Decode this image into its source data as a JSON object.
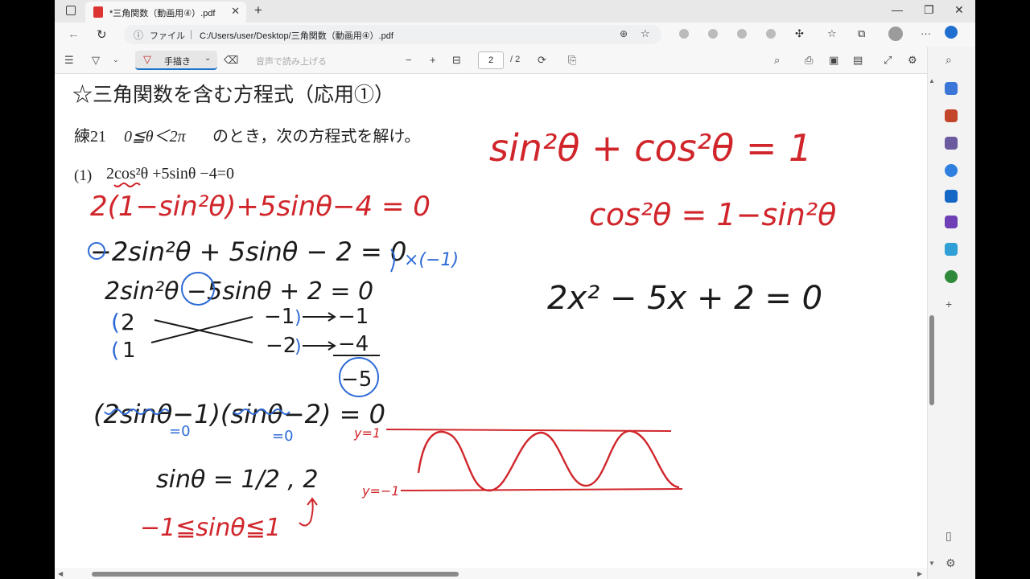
{
  "tab": {
    "title": "*三角関数（動画用④）.pdf"
  },
  "window": {
    "minimize": "—",
    "restore": "❐",
    "close": "✕",
    "new_tab": "+"
  },
  "address": {
    "label": "ファイル",
    "url": "C:/Users/user/Desktop/三角関数（動画用④）.pdf"
  },
  "toolbar": {
    "draw_label": "手描き",
    "read_aloud": "音声で読み上げる",
    "zoom_out": "−",
    "zoom_in": "+",
    "page_current": "2",
    "page_total": "/ 2"
  },
  "document": {
    "heading": "☆三角関数を含む方程式（応用①）",
    "exercise_label": "練21",
    "condition": "0≦θ＜2π",
    "instruction": "のとき，次の方程式を解け。",
    "problem_num": "(1)",
    "problem_eq": "2cos²θ +5sinθ −4=0",
    "hw_steps": [
      "2(1−sin²θ)+5sinθ−4 = 0",
      "−2sin²θ + 5sinθ − 2 = 0",
      "2sin²θ −5sinθ + 2 = 0",
      "(2sinθ−1)(sinθ−2) = 0",
      "sinθ = 1/2 , 2",
      "−1≦sinθ≦1"
    ],
    "hw_multiply": "×(−1)",
    "hw_factor": {
      "left_top": "2",
      "left_bottom": "1",
      "right_top": "−1",
      "right_bottom": "−2",
      "prod_top": "−1",
      "prod_bottom": "−4",
      "sum": "−5"
    },
    "hw_zero_a": "=0",
    "hw_zero_b": "=0",
    "hw_identity": "sin²θ + cos²θ = 1",
    "hw_cos_identity": "cos²θ = 1−sin²θ",
    "hw_quadratic": "2x² − 5x + 2 = 0",
    "hw_y_top": "y=1",
    "hw_y_bottom": "y=−1"
  },
  "colors": {
    "ink_black": "#1b1b1b",
    "ink_red": "#d0262b",
    "ink_blue": "#2d6ad6",
    "accent": "#1a73c9"
  }
}
